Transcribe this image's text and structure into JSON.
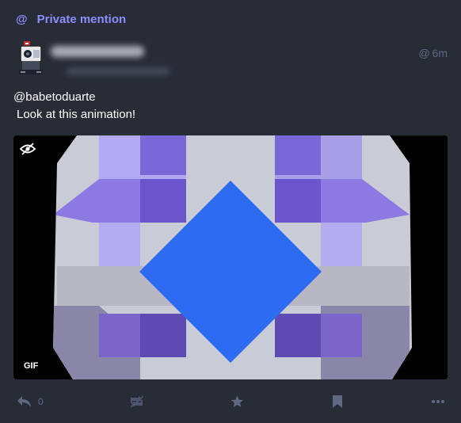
{
  "prepend": {
    "icon": "at-icon",
    "label": "Private mention"
  },
  "status": {
    "time": "6m",
    "mention": "@babetoduarte",
    "text": "Look at this animation!"
  },
  "media": {
    "badge": "GIF"
  },
  "actions": {
    "reply_count": "0"
  },
  "colors": {
    "accent": "#8c8dff",
    "background": "#282c37",
    "muted": "#606984",
    "media_bg": "#000000"
  }
}
